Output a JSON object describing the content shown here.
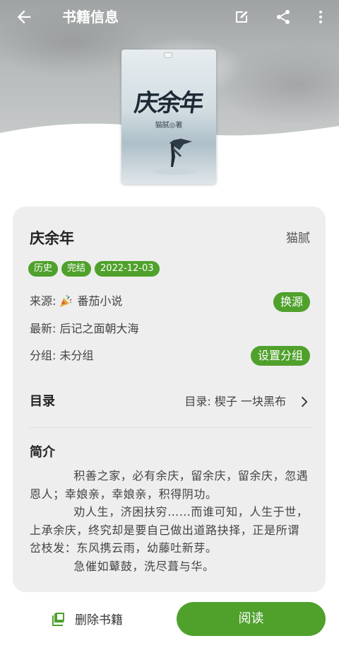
{
  "header": {
    "title": "书籍信息",
    "icons": [
      "back-arrow-icon",
      "edit-icon",
      "share-icon",
      "more-vertical-icon"
    ]
  },
  "cover": {
    "title": "庆余年",
    "author_line": "猫腻◎著"
  },
  "book": {
    "name": "庆余年",
    "author": "猫腻",
    "tags": [
      "历史",
      "完结",
      "2022-12-03"
    ],
    "source_label": "来源:",
    "source_value": "番茄小说",
    "source_icon": "party-popper-icon",
    "latest": "最新: 后记之面朝大海",
    "group": "分组: 未分组",
    "change_source_button": "换源",
    "set_group_button": "设置分组"
  },
  "toc": {
    "heading": "目录",
    "latest": "目录: 楔子 一块黑布"
  },
  "intro": {
    "heading": "简介",
    "paragraphs": [
      "积善之家，必有余庆，留余庆，留余庆，忽遇恩人；幸娘亲，幸娘亲，积得阴功。",
      "劝人生，济困扶穷……而谁可知，人生于世，上承余庆，终究却是要自己做出道路抉择，正是所谓岔枝发：东风携云雨，幼藤吐新芽。",
      "急催如鼙鼓，洗尽葺与华。"
    ]
  },
  "bottom": {
    "delete_label": "删除书籍",
    "read_label": "阅读"
  },
  "colors": {
    "accent": "#4fa12c",
    "card_bg": "#eeeeee"
  }
}
